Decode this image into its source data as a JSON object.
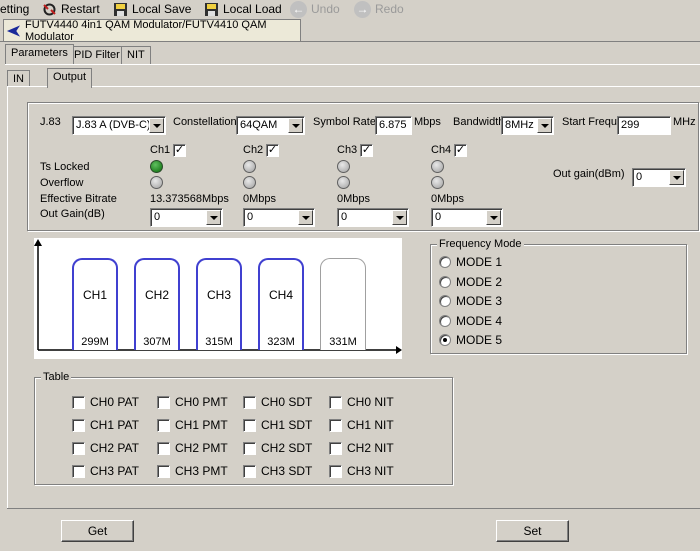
{
  "toolbar": {
    "items": [
      {
        "label": "etting"
      },
      {
        "label": "Restart"
      },
      {
        "label": "Local Save"
      },
      {
        "label": "Local Load"
      },
      {
        "label": "Undo"
      },
      {
        "label": "Redo"
      }
    ]
  },
  "device_tab": {
    "label": "FUTV4440 4in1 QAM Modulator/FUTV4410 QAM Modulator"
  },
  "tabs": {
    "main": [
      "Parameters",
      "PID Filter",
      "NIT"
    ],
    "sub": [
      "IN",
      "Output"
    ]
  },
  "params": {
    "j83_label": "J.83",
    "j83_value": "J.83 A (DVB-C)",
    "constellation_label": "Constellation",
    "constellation_value": "64QAM",
    "symbol_rate_label": "Symbol Rate",
    "symbol_rate_value": "6.875",
    "symbol_rate_unit": "Mbps",
    "bandwidth_label": "Bandwidth",
    "bandwidth_value": "8MHz",
    "start_freq_label": "Start Freque",
    "start_freq_value": "299",
    "start_freq_unit": "MHz"
  },
  "status": {
    "ts_locked_label": "Ts Locked",
    "overflow_label": "Overflow",
    "bitrate_label": "Effective Bitrate",
    "out_gain_db_label": "Out Gain(dB)",
    "out_gain_dbm_label": "Out gain(dBm)",
    "out_gain_dbm_value": "0"
  },
  "channels": [
    {
      "name": "Ch1",
      "checked": true,
      "ts_locked": true,
      "overflow": false,
      "bitrate": "13.373568Mbps",
      "gain": "0"
    },
    {
      "name": "Ch2",
      "checked": true,
      "ts_locked": false,
      "overflow": false,
      "bitrate": "0Mbps",
      "gain": "0"
    },
    {
      "name": "Ch3",
      "checked": true,
      "ts_locked": false,
      "overflow": false,
      "bitrate": "0Mbps",
      "gain": "0"
    },
    {
      "name": "Ch4",
      "checked": true,
      "ts_locked": false,
      "overflow": false,
      "bitrate": "0Mbps",
      "gain": "0"
    }
  ],
  "diagram": {
    "boxes": [
      {
        "name": "CH1",
        "freq": "299M"
      },
      {
        "name": "CH2",
        "freq": "307M"
      },
      {
        "name": "CH3",
        "freq": "315M"
      },
      {
        "name": "CH4",
        "freq": "323M"
      },
      {
        "name": "",
        "freq": "331M"
      }
    ]
  },
  "frequency_mode": {
    "title": "Frequency Mode",
    "options": [
      "MODE 1",
      "MODE 2",
      "MODE 3",
      "MODE 4",
      "MODE 5"
    ],
    "selected": 4
  },
  "table": {
    "title": "Table",
    "rows": [
      [
        "CH0 PAT",
        "CH0 PMT",
        "CH0 SDT",
        "CH0 NIT"
      ],
      [
        "CH1 PAT",
        "CH1 PMT",
        "CH1 SDT",
        "CH1 NIT"
      ],
      [
        "CH2 PAT",
        "CH2 PMT",
        "CH2 SDT",
        "CH2 NIT"
      ],
      [
        "CH3 PAT",
        "CH3 PMT",
        "CH3 SDT",
        "CH3 NIT"
      ]
    ]
  },
  "buttons": {
    "get": "Get",
    "set": "Set"
  },
  "colors": {
    "led_on": "#0a6a0a",
    "channel_border": "#4040d0",
    "device_arrow": "#1a2a9a"
  }
}
